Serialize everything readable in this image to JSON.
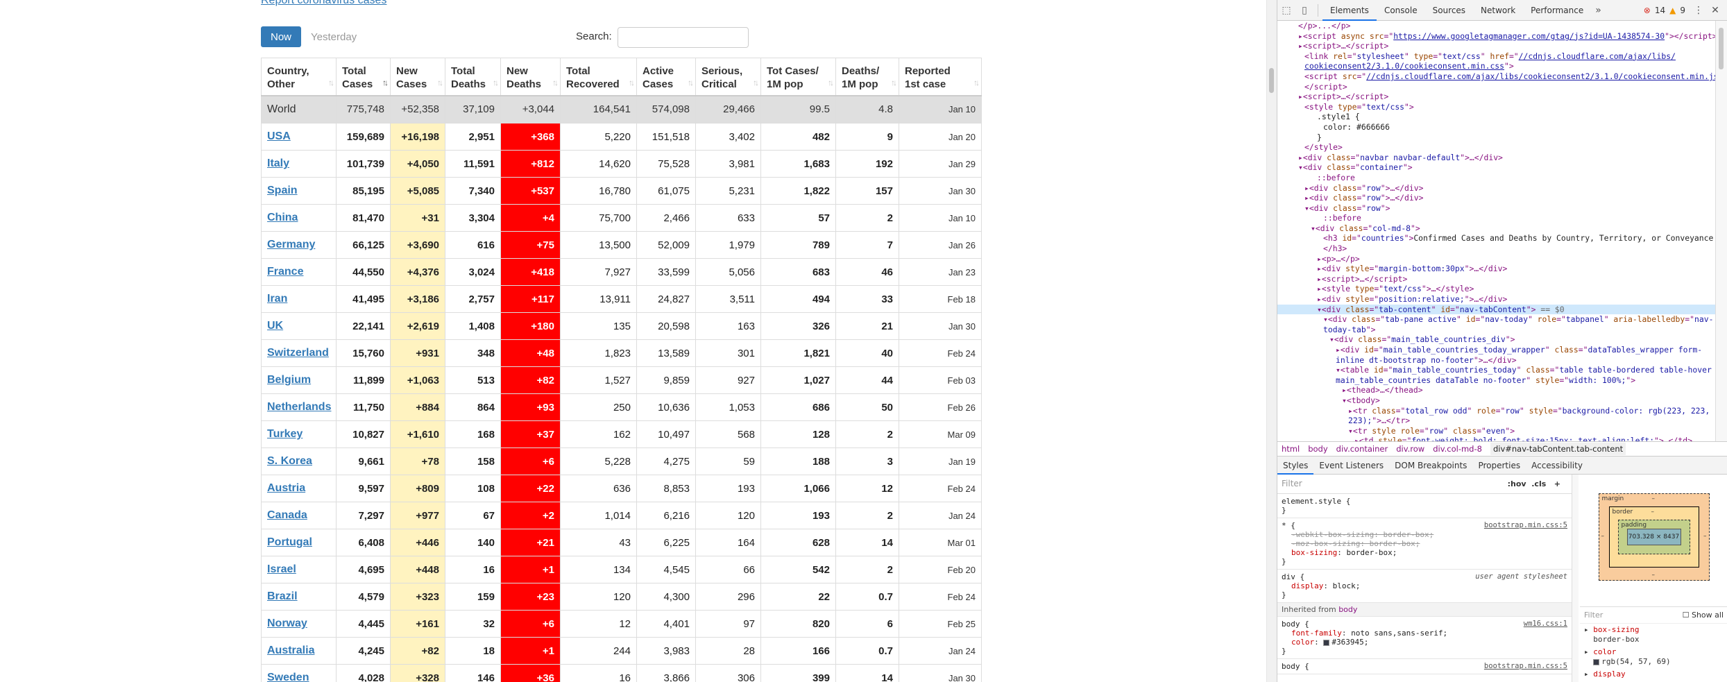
{
  "page": {
    "top_link": "Report coronavirus cases",
    "tabs": {
      "now": "Now",
      "yesterday": "Yesterday"
    },
    "search": {
      "label": "Search:",
      "value": "",
      "placeholder": ""
    },
    "table": {
      "headers": [
        {
          "line1": "Country,",
          "line2": "Other"
        },
        {
          "line1": "Total",
          "line2": "Cases"
        },
        {
          "line1": "New",
          "line2": "Cases"
        },
        {
          "line1": "Total",
          "line2": "Deaths"
        },
        {
          "line1": "New",
          "line2": "Deaths"
        },
        {
          "line1": "Total",
          "line2": "Recovered"
        },
        {
          "line1": "Active",
          "line2": "Cases"
        },
        {
          "line1": "Serious,",
          "line2": "Critical"
        },
        {
          "line1": "Tot Cases/",
          "line2": "1M pop"
        },
        {
          "line1": "Deaths/",
          "line2": "1M pop"
        },
        {
          "line1": "Reported",
          "line2": "1st case"
        }
      ],
      "world": [
        "World",
        "775,748",
        "+52,358",
        "37,109",
        "+3,044",
        "164,541",
        "574,098",
        "29,466",
        "99.5",
        "4.8",
        "Jan 10"
      ],
      "rows": [
        [
          "USA",
          "159,689",
          "+16,198",
          "2,951",
          "+368",
          "5,220",
          "151,518",
          "3,402",
          "482",
          "9",
          "Jan 20"
        ],
        [
          "Italy",
          "101,739",
          "+4,050",
          "11,591",
          "+812",
          "14,620",
          "75,528",
          "3,981",
          "1,683",
          "192",
          "Jan 29"
        ],
        [
          "Spain",
          "85,195",
          "+5,085",
          "7,340",
          "+537",
          "16,780",
          "61,075",
          "5,231",
          "1,822",
          "157",
          "Jan 30"
        ],
        [
          "China",
          "81,470",
          "+31",
          "3,304",
          "+4",
          "75,700",
          "2,466",
          "633",
          "57",
          "2",
          "Jan 10"
        ],
        [
          "Germany",
          "66,125",
          "+3,690",
          "616",
          "+75",
          "13,500",
          "52,009",
          "1,979",
          "789",
          "7",
          "Jan 26"
        ],
        [
          "France",
          "44,550",
          "+4,376",
          "3,024",
          "+418",
          "7,927",
          "33,599",
          "5,056",
          "683",
          "46",
          "Jan 23"
        ],
        [
          "Iran",
          "41,495",
          "+3,186",
          "2,757",
          "+117",
          "13,911",
          "24,827",
          "3,511",
          "494",
          "33",
          "Feb 18"
        ],
        [
          "UK",
          "22,141",
          "+2,619",
          "1,408",
          "+180",
          "135",
          "20,598",
          "163",
          "326",
          "21",
          "Jan 30"
        ],
        [
          "Switzerland",
          "15,760",
          "+931",
          "348",
          "+48",
          "1,823",
          "13,589",
          "301",
          "1,821",
          "40",
          "Feb 24"
        ],
        [
          "Belgium",
          "11,899",
          "+1,063",
          "513",
          "+82",
          "1,527",
          "9,859",
          "927",
          "1,027",
          "44",
          "Feb 03"
        ],
        [
          "Netherlands",
          "11,750",
          "+884",
          "864",
          "+93",
          "250",
          "10,636",
          "1,053",
          "686",
          "50",
          "Feb 26"
        ],
        [
          "Turkey",
          "10,827",
          "+1,610",
          "168",
          "+37",
          "162",
          "10,497",
          "568",
          "128",
          "2",
          "Mar 09"
        ],
        [
          "S. Korea",
          "9,661",
          "+78",
          "158",
          "+6",
          "5,228",
          "4,275",
          "59",
          "188",
          "3",
          "Jan 19"
        ],
        [
          "Austria",
          "9,597",
          "+809",
          "108",
          "+22",
          "636",
          "8,853",
          "193",
          "1,066",
          "12",
          "Feb 24"
        ],
        [
          "Canada",
          "7,297",
          "+977",
          "67",
          "+2",
          "1,014",
          "6,216",
          "120",
          "193",
          "2",
          "Jan 24"
        ],
        [
          "Portugal",
          "6,408",
          "+446",
          "140",
          "+21",
          "43",
          "6,225",
          "164",
          "628",
          "14",
          "Mar 01"
        ],
        [
          "Israel",
          "4,695",
          "+448",
          "16",
          "+1",
          "134",
          "4,545",
          "66",
          "542",
          "2",
          "Feb 20"
        ],
        [
          "Brazil",
          "4,579",
          "+323",
          "159",
          "+23",
          "120",
          "4,300",
          "296",
          "22",
          "0.7",
          "Feb 24"
        ],
        [
          "Norway",
          "4,445",
          "+161",
          "32",
          "+6",
          "12",
          "4,401",
          "97",
          "820",
          "6",
          "Feb 25"
        ],
        [
          "Australia",
          "4,245",
          "+82",
          "18",
          "+1",
          "244",
          "3,983",
          "28",
          "166",
          "0.7",
          "Jan 24"
        ],
        [
          "Sweden",
          "4,028",
          "+328",
          "146",
          "+36",
          "16",
          "3,866",
          "306",
          "399",
          "14",
          "Jan 30"
        ]
      ]
    }
  },
  "devtools": {
    "tabs": [
      "Elements",
      "Console",
      "Sources",
      "Network",
      "Performance"
    ],
    "active_tab": "Elements",
    "more": "»",
    "errors": "14",
    "warnings": "9",
    "dom_lines": [
      {
        "i": 2,
        "h": "<span class=\"tg\">&lt;/p&gt;...&lt;/p&gt;</span>"
      },
      {
        "i": 2,
        "h": "<span class=\"tg\">▸&lt;script</span> <span class=\"at\">async</span> <span class=\"at\">src</span>=\"<span class=\"lk\">https://www.googletagmanager.com/gtag/js?id=UA-1438574-30</span>\"<span class=\"tg\">&gt;&lt;/script&gt;</span>"
      },
      {
        "i": 2,
        "h": "<span class=\"tg\">▸&lt;script&gt;</span>…<span class=\"tg\">&lt;/script&gt;</span>"
      },
      {
        "i": 3,
        "h": "<span class=\"tg\">&lt;link</span> <span class=\"at\">rel</span>=\"<span class=\"av\">stylesheet</span>\" <span class=\"at\">type</span>=\"<span class=\"av\">text/css</span>\" <span class=\"at\">href</span>=\"<span class=\"lk\">//cdnjs.cloudflare.com/ajax/libs/</span>"
      },
      {
        "i": 3,
        "h": "<span class=\"lk\">cookieconsent2/3.1.0/cookieconsent.min.css</span>\"<span class=\"tg\">&gt;</span>"
      },
      {
        "i": 3,
        "h": "<span class=\"tg\">&lt;script</span> <span class=\"at\">src</span>=\"<span class=\"lk\">//cdnjs.cloudflare.com/ajax/libs/cookieconsent2/3.1.0/cookieconsent.min.js</span>\"<span class=\"tg\">&gt;</span>"
      },
      {
        "i": 3,
        "h": "<span class=\"tg\">&lt;/script&gt;</span>"
      },
      {
        "i": 2,
        "h": "<span class=\"tg\">▸&lt;script&gt;</span>…<span class=\"tg\">&lt;/script&gt;</span>"
      },
      {
        "i": 3,
        "h": "<span class=\"tg\">&lt;style</span> <span class=\"at\">type</span>=\"<span class=\"av\">text/css</span>\"<span class=\"tg\">&gt;</span>"
      },
      {
        "i": 5,
        "h": "<span class=\"tx\">.style1 {</span>"
      },
      {
        "i": 6,
        "h": "<span class=\"tx\">color: #666666</span>"
      },
      {
        "i": 5,
        "h": "<span class=\"tx\">}</span>"
      },
      {
        "i": 3,
        "h": "<span class=\"tg\">&lt;/style&gt;</span>"
      },
      {
        "i": 2,
        "h": "<span class=\"tg\">▸&lt;div</span> <span class=\"at\">class</span>=\"<span class=\"av\">navbar navbar-default</span>\"<span class=\"tg\">&gt;</span>…<span class=\"tg\">&lt;/div&gt;</span>"
      },
      {
        "i": 2,
        "h": "<span class=\"tg\">▾&lt;div</span> <span class=\"at\">class</span>=\"<span class=\"av\">container</span>\"<span class=\"tg\">&gt;</span>"
      },
      {
        "i": 5,
        "h": "<span class=\"ps\">::before</span>"
      },
      {
        "i": 3,
        "h": "<span class=\"tg\">▸&lt;div</span> <span class=\"at\">class</span>=\"<span class=\"av\">row</span>\"<span class=\"tg\">&gt;</span>…<span class=\"tg\">&lt;/div&gt;</span>"
      },
      {
        "i": 3,
        "h": "<span class=\"tg\">▸&lt;div</span> <span class=\"at\">class</span>=\"<span class=\"av\">row</span>\"<span class=\"tg\">&gt;</span>…<span class=\"tg\">&lt;/div&gt;</span>"
      },
      {
        "i": 3,
        "h": "<span class=\"tg\">▾&lt;div</span> <span class=\"at\">class</span>=\"<span class=\"av\">row</span>\"<span class=\"tg\">&gt;</span>"
      },
      {
        "i": 6,
        "h": "<span class=\"ps\">::before</span>"
      },
      {
        "i": 4,
        "h": "<span class=\"tg\">▾&lt;div</span> <span class=\"at\">class</span>=\"<span class=\"av\">col-md-8</span>\"<span class=\"tg\">&gt;</span>"
      },
      {
        "i": 6,
        "h": "<span class=\"tg\">&lt;h3</span> <span class=\"at\">id</span>=\"<span class=\"av\">countries</span>\"<span class=\"tg\">&gt;</span><span class=\"tx\">Confirmed Cases and Deaths by Country, Territory, or Conveyance</span>"
      },
      {
        "i": 6,
        "h": "<span class=\"tg\">&lt;/h3&gt;</span>"
      },
      {
        "i": 5,
        "h": "<span class=\"tg\">▸&lt;p&gt;</span>…<span class=\"tg\">&lt;/p&gt;</span>"
      },
      {
        "i": 5,
        "h": "<span class=\"tg\">▸&lt;div</span> <span class=\"at\">style</span>=\"<span class=\"av\">margin-bottom:30px</span>\"<span class=\"tg\">&gt;</span>…<span class=\"tg\">&lt;/div&gt;</span>"
      },
      {
        "i": 5,
        "h": "<span class=\"tg\">▸&lt;script&gt;</span>…<span class=\"tg\">&lt;/script&gt;</span>"
      },
      {
        "i": 5,
        "h": "<span class=\"tg\">▸&lt;style</span> <span class=\"at\">type</span>=\"<span class=\"av\">text/css</span>\"<span class=\"tg\">&gt;</span>…<span class=\"tg\">&lt;/style&gt;</span>"
      },
      {
        "i": 5,
        "h": "<span class=\"tg\">▸&lt;div</span> <span class=\"at\">style</span>=\"<span class=\"av\">position:relative;</span>\"<span class=\"tg\">&gt;</span>…<span class=\"tg\">&lt;/div&gt;</span>"
      },
      {
        "i": 5,
        "sel": true,
        "h": "<span class=\"tg\">▾&lt;div</span> <span class=\"at\">class</span>=\"<span class=\"av\">tab-content</span>\" <span class=\"at\">id</span>=\"<span class=\"av\">nav-tabContent</span>\"<span class=\"tg\">&gt;</span> <span class=\"cm\">== $0</span>"
      },
      {
        "i": 6,
        "h": "<span class=\"tg\">▾&lt;div</span> <span class=\"at\">class</span>=\"<span class=\"av\">tab-pane active</span>\" <span class=\"at\">id</span>=\"<span class=\"av\">nav-today</span>\" <span class=\"at\">role</span>=\"<span class=\"av\">tabpanel</span>\" <span class=\"at\">aria-labelledby</span>=\"<span class=\"av\">nav-</span>"
      },
      {
        "i": 6,
        "h": "<span class=\"av\">today-tab</span>\"<span class=\"tg\">&gt;</span>"
      },
      {
        "i": 7,
        "h": "<span class=\"tg\">▾&lt;div</span> <span class=\"at\">class</span>=\"<span class=\"av\">main_table_countries_div</span>\"<span class=\"tg\">&gt;</span>"
      },
      {
        "i": 8,
        "h": "<span class=\"tg\">▸&lt;div</span> <span class=\"at\">id</span>=\"<span class=\"av\">main_table_countries_today_wrapper</span>\" <span class=\"at\">class</span>=\"<span class=\"av\">dataTables_wrapper form-</span>"
      },
      {
        "i": 8,
        "h": "<span class=\"av\">inline dt-bootstrap no-footer</span>\"<span class=\"tg\">&gt;</span>…<span class=\"tg\">&lt;/div&gt;</span>"
      },
      {
        "i": 8,
        "h": "<span class=\"tg\">▾&lt;table</span> <span class=\"at\">id</span>=\"<span class=\"av\">main_table_countries_today</span>\" <span class=\"at\">class</span>=\"<span class=\"av\">table table-bordered table-hover</span>"
      },
      {
        "i": 8,
        "h": "<span class=\"av\">main_table_countries dataTable no-footer</span>\" <span class=\"at\">style</span>=\"<span class=\"av\">width: 100%;</span>\"<span class=\"tg\">&gt;</span>"
      },
      {
        "i": 9,
        "h": "<span class=\"tg\">▸&lt;thead&gt;</span>…<span class=\"tg\">&lt;/thead&gt;</span>"
      },
      {
        "i": 9,
        "h": "<span class=\"tg\">▾&lt;tbody&gt;</span>"
      },
      {
        "i": 10,
        "h": "<span class=\"tg\">▸&lt;tr</span> <span class=\"at\">class</span>=\"<span class=\"av\">total_row odd</span>\" <span class=\"at\">role</span>=\"<span class=\"av\">row</span>\" <span class=\"at\">style</span>=\"<span class=\"av\">background-color: rgb(223, 223,</span>"
      },
      {
        "i": 10,
        "h": "<span class=\"av\">223);</span>\"<span class=\"tg\">&gt;</span>…<span class=\"tg\">&lt;/tr&gt;</span>"
      },
      {
        "i": 10,
        "h": "<span class=\"tg\">▾&lt;tr</span> <span class=\"at\">style</span> <span class=\"at\">role</span>=\"<span class=\"av\">row</span>\" <span class=\"at\">class</span>=\"<span class=\"av\">even</span>\"<span class=\"tg\">&gt;</span>"
      },
      {
        "i": 11,
        "h": "<span class=\"tg\">▸&lt;td</span> <span class=\"at\">style</span>=\"<span class=\"av\">font-weight: bold; font-size:15px; text-align:left;</span>\"<span class=\"tg\">&gt;</span>…<span class=\"tg\">&lt;/td&gt;</span>"
      }
    ],
    "breadcrumb": [
      "html",
      "body",
      "div.container",
      "div.row",
      "div.col-md-8",
      "div#nav-tabContent.tab-content"
    ],
    "sub_tabs": [
      "Styles",
      "Event Listeners",
      "DOM Breakpoints",
      "Properties",
      "Accessibility"
    ],
    "active_sub_tab": "Styles",
    "styles": {
      "filter_placeholder": "Filter",
      "hov": ":hov",
      "cls": ".cls",
      "plus": "+",
      "element_style": "element.style {",
      "element_style_close": "}",
      "rule1_sel": "* {",
      "rule1_src": "bootstrap.min.css:5",
      "rule1_p1": "-webkit-box-sizing: border-box;",
      "rule1_p2": "-moz-box-sizing: border-box;",
      "rule1_p3n": "box-sizing",
      "rule1_p3v": "border-box;",
      "rule2_sel": "div {",
      "rule2_src": "user agent stylesheet",
      "rule2_pn": "display",
      "rule2_pv": "block;",
      "inherited_label": "Inherited from",
      "inherited_from": "body",
      "rule3_sel": "body {",
      "rule3_src": "wm16.css:1",
      "rule3_p1n": "font-family",
      "rule3_p1v": "noto sans,sans-serif;",
      "rule3_p2n": "color",
      "rule3_p2v": "#363945;",
      "rule4_sel": "body {",
      "rule4_src": "bootstrap.min.css:5",
      "close": "}"
    },
    "boxmodel": {
      "margin": "margin",
      "border": "border",
      "padding": "padding",
      "content": "703.328 × 8437",
      "dash": "–"
    },
    "computed": {
      "filter_placeholder": "Filter",
      "show_all": "Show all",
      "p1n": "box-sizing",
      "p1v": "border-box",
      "p2n": "color",
      "p2v": "rgb(54, 57, 69)",
      "p3n": "display"
    }
  }
}
